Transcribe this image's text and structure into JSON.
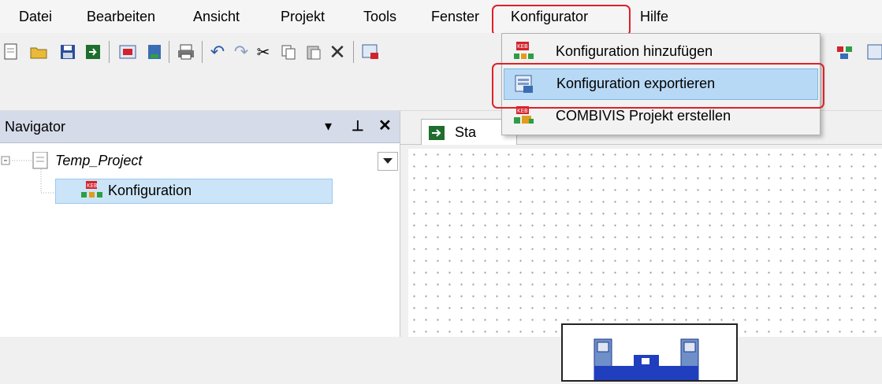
{
  "menubar": {
    "items": [
      "Datei",
      "Bearbeiten",
      "Ansicht",
      "Projekt",
      "Tools",
      "Fenster",
      "Konfigurator",
      "Hilfe"
    ]
  },
  "konfigurator_menu": {
    "items": [
      {
        "label": "Konfiguration hinzufügen",
        "icon": "keb-config-add-icon"
      },
      {
        "label": "Konfiguration exportieren",
        "icon": "export-icon",
        "selected": true
      },
      {
        "label": "COMBIVIS Projekt erstellen",
        "icon": "combivis-project-icon"
      }
    ]
  },
  "navigator": {
    "title": "Navigator",
    "tree": {
      "root": "Temp_Project",
      "child": "Konfiguration"
    }
  },
  "editor": {
    "tab_label": "Sta"
  },
  "colors": {
    "highlight": "#e0202a",
    "selection": "#b7d9f5",
    "nav_header": "#d6dbe9"
  }
}
